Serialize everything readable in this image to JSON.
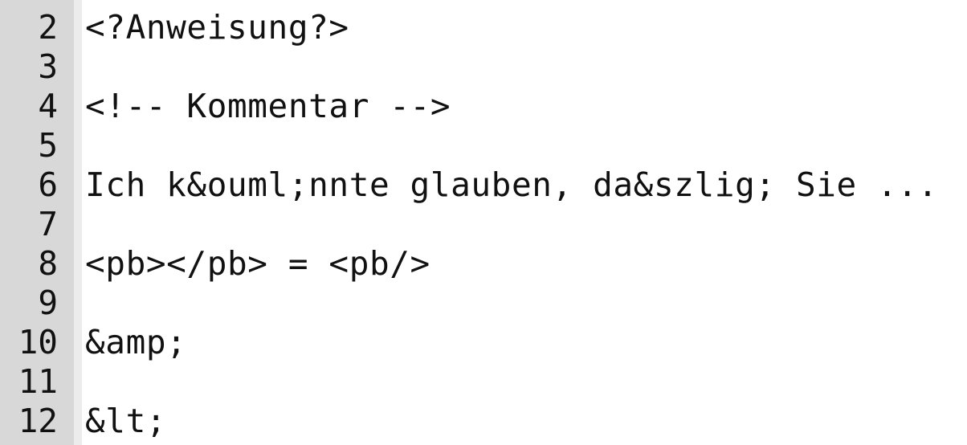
{
  "editor": {
    "lines": [
      {
        "number": "2",
        "text": "<?Anweisung?>"
      },
      {
        "number": "3",
        "text": ""
      },
      {
        "number": "4",
        "text": "<!-- Kommentar -->"
      },
      {
        "number": "5",
        "text": ""
      },
      {
        "number": "6",
        "text": "Ich k&ouml;nnte glauben, da&szlig; Sie ..."
      },
      {
        "number": "7",
        "text": ""
      },
      {
        "number": "8",
        "text": "<pb></pb> = <pb/>"
      },
      {
        "number": "9",
        "text": ""
      },
      {
        "number": "10",
        "text": "&amp;"
      },
      {
        "number": "11",
        "text": ""
      },
      {
        "number": "12",
        "text": "&lt;"
      }
    ]
  },
  "colors": {
    "gutter": "#d8d8d8",
    "text": "#111111",
    "background": "#ffffff"
  }
}
